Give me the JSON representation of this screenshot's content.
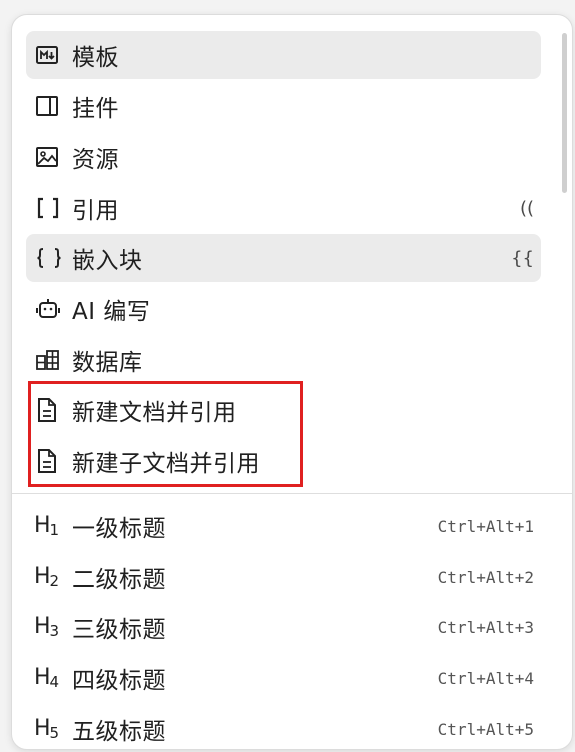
{
  "menu": {
    "items": [
      {
        "label": "模板",
        "icon": "markdown-icon",
        "shortcut": ""
      },
      {
        "label": "挂件",
        "icon": "widget-icon",
        "shortcut": ""
      },
      {
        "label": "资源",
        "icon": "image-icon",
        "shortcut": ""
      },
      {
        "label": "引用",
        "icon": "brackets-icon",
        "shortcut": "(("
      },
      {
        "label": "嵌入块",
        "icon": "braces-icon",
        "shortcut": "{{"
      },
      {
        "label": "AI 编写",
        "icon": "robot-icon",
        "shortcut": ""
      },
      {
        "label": "数据库",
        "icon": "database-icon",
        "shortcut": ""
      },
      {
        "label": "新建文档并引用",
        "icon": "document-icon",
        "shortcut": ""
      },
      {
        "label": "新建子文档并引用",
        "icon": "document-icon",
        "shortcut": ""
      }
    ],
    "headings": [
      {
        "glyph": "H",
        "level": "1",
        "label": "一级标题",
        "shortcut": "Ctrl+Alt+1"
      },
      {
        "glyph": "H",
        "level": "2",
        "label": "二级标题",
        "shortcut": "Ctrl+Alt+2"
      },
      {
        "glyph": "H",
        "level": "3",
        "label": "三级标题",
        "shortcut": "Ctrl+Alt+3"
      },
      {
        "glyph": "H",
        "level": "4",
        "label": "四级标题",
        "shortcut": "Ctrl+Alt+4"
      },
      {
        "glyph": "H",
        "level": "5",
        "label": "五级标题",
        "shortcut": "Ctrl+Alt+5"
      }
    ]
  },
  "colors": {
    "highlight": "#ebebeb",
    "annotation_box": "#e02020"
  }
}
